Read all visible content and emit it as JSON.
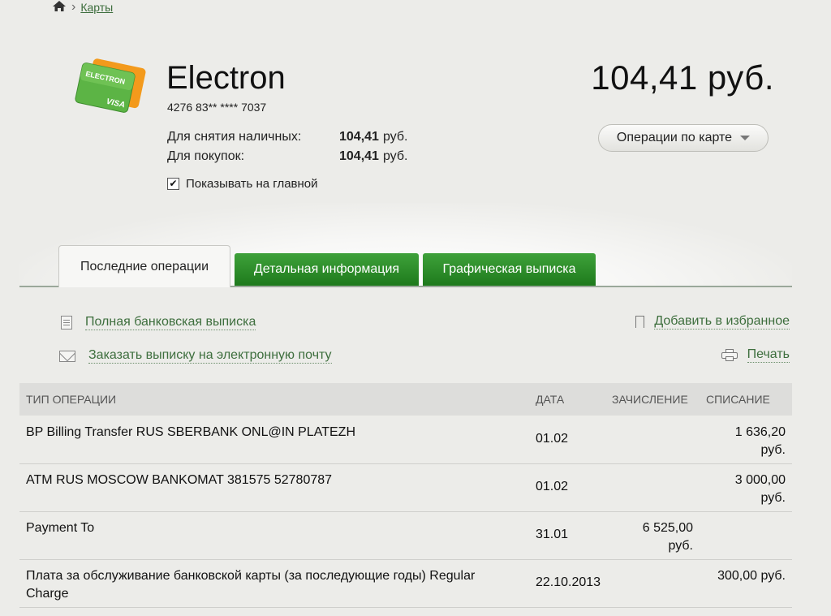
{
  "breadcrumb": {
    "current": "Карты",
    "home_icon": "home-icon"
  },
  "card": {
    "title": "Electron",
    "number": "4276 83** **** 7037",
    "cash_label": "Для снятия наличных:",
    "cash_value": "104,41",
    "purchase_label": "Для покупок:",
    "purchase_value": "104,41",
    "currency": "руб.",
    "show_on_main_label": "Показывать на главной",
    "show_on_main_checked": true,
    "total": "104,41 руб.",
    "operations_button": "Операции по карте",
    "card_brand_text": "ELECTRON",
    "card_network_text": "VISA"
  },
  "tabs": [
    {
      "label": "Последние операции",
      "active": true
    },
    {
      "label": "Детальная информация",
      "active": false
    },
    {
      "label": "Графическая выписка",
      "active": false
    }
  ],
  "actions": {
    "full_statement": "Полная банковская выписка",
    "email_statement": "Заказать выписку на электронную почту",
    "add_favorite": "Добавить в избранное",
    "print": "Печать"
  },
  "table": {
    "headers": {
      "type": "ТИП ОПЕРАЦИИ",
      "date": "ДАТА",
      "credit": "ЗАЧИСЛЕНИЕ",
      "debit": "СПИСАНИЕ"
    },
    "rows": [
      {
        "name": "BP Billing Transfer RUS SBERBANK ONL@IN PLATEZH",
        "date": "01.02",
        "credit": "",
        "debit": "1 636,20\nруб."
      },
      {
        "name": "ATM RUS MOSCOW BANKOMAT 381575 52780787",
        "date": "01.02",
        "credit": "",
        "debit": "3 000,00\nруб."
      },
      {
        "name": "Payment To",
        "date": "31.01",
        "credit": "6 525,00\nруб.",
        "debit": ""
      },
      {
        "name": "Плата за обслуживание банковской карты (за последующие годы) Regular Charge",
        "date": "22.10.2013",
        "credit": "",
        "debit": "300,00 руб."
      }
    ]
  },
  "colors": {
    "tab_green": "#2a8a27",
    "link_green": "#3d6e3d",
    "background": "#ecece9"
  }
}
